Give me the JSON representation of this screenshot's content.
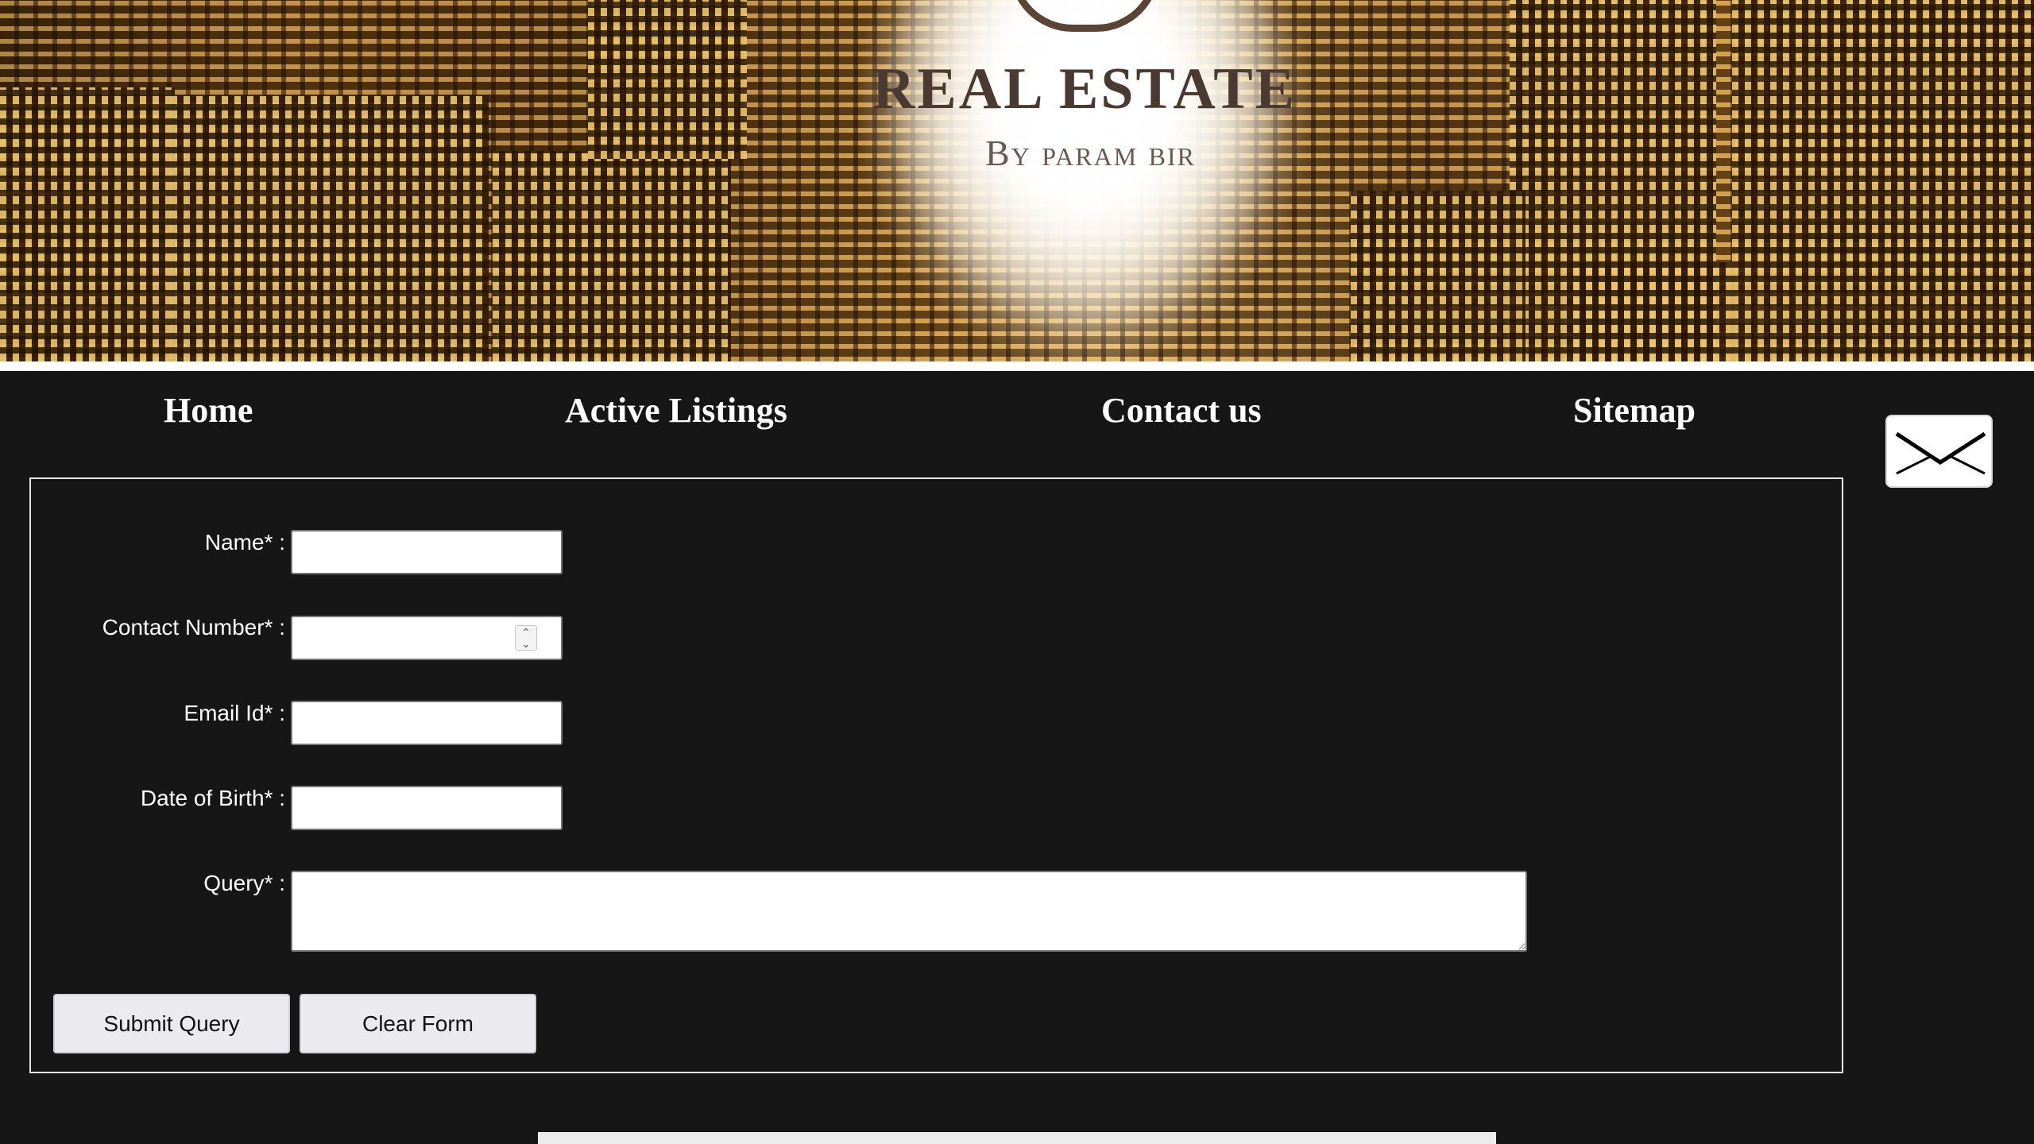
{
  "header": {
    "brand_title": "REAL ESTATE",
    "brand_subtitle": "By param bir"
  },
  "nav": {
    "items": [
      {
        "label": "Home"
      },
      {
        "label": "Active Listings"
      },
      {
        "label": "Contact us"
      },
      {
        "label": "Sitemap"
      }
    ],
    "mail_icon": "envelope-icon"
  },
  "form": {
    "fields": {
      "name": {
        "label": "Name* :",
        "value": ""
      },
      "contact": {
        "label": "Contact Number* :",
        "value": ""
      },
      "email": {
        "label": "Email Id* :",
        "value": ""
      },
      "dob": {
        "label": "Date of Birth* :",
        "value": ""
      },
      "query": {
        "label": "Query* :",
        "value": ""
      }
    },
    "buttons": {
      "submit": "Submit Query",
      "clear": "Clear Form"
    }
  }
}
